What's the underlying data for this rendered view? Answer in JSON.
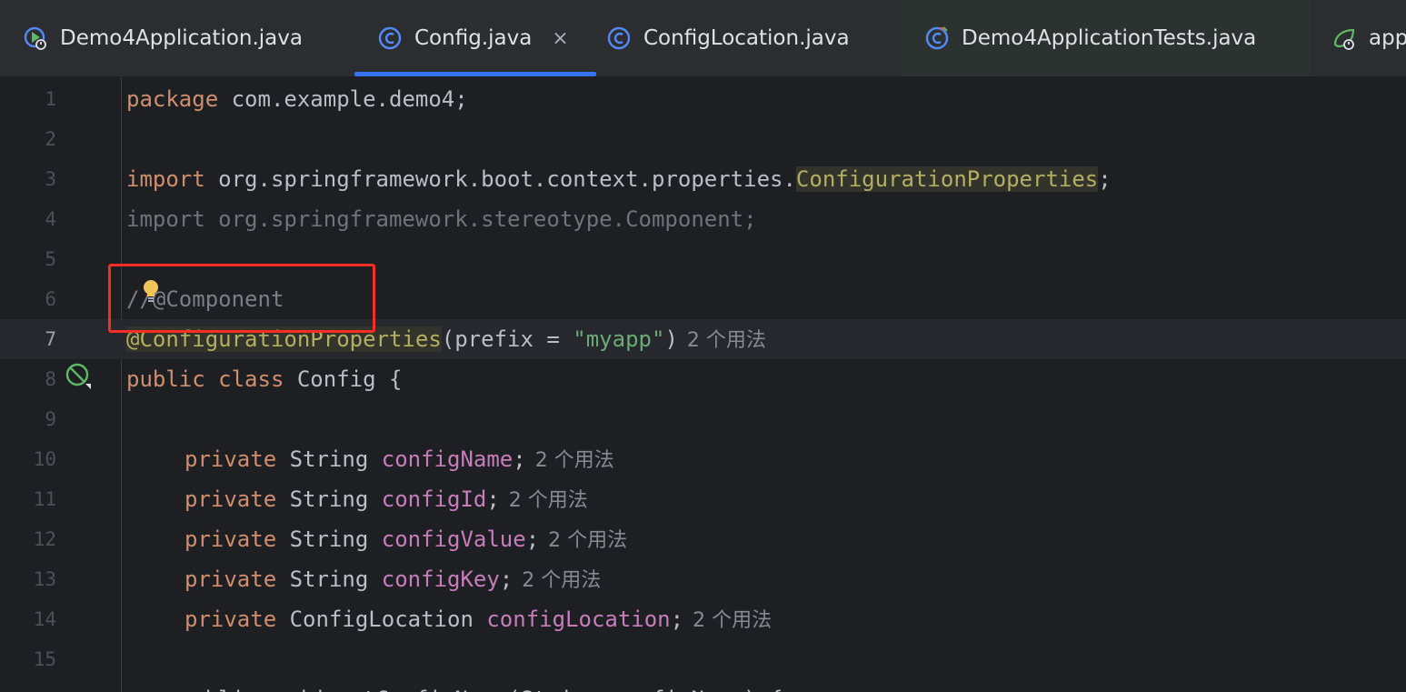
{
  "tabs": [
    {
      "label": "Demo4Application.java",
      "icon": "spring-boot-run-class-icon"
    },
    {
      "label": "Config.java",
      "icon": "class-icon",
      "active": true,
      "close": "×"
    },
    {
      "label": "ConfigLocation.java",
      "icon": "class-icon"
    },
    {
      "label": "Demo4ApplicationTests.java",
      "icon": "test-class-icon"
    },
    {
      "label": "app",
      "icon": "spring-config-icon"
    }
  ],
  "editor": {
    "current_line": 7,
    "lines": [
      {
        "n": "1"
      },
      {
        "n": "2"
      },
      {
        "n": "3"
      },
      {
        "n": "4"
      },
      {
        "n": "5"
      },
      {
        "n": "6"
      },
      {
        "n": "7"
      },
      {
        "n": "8"
      },
      {
        "n": "9"
      },
      {
        "n": "10"
      },
      {
        "n": "11"
      },
      {
        "n": "12"
      },
      {
        "n": "13"
      },
      {
        "n": "14"
      },
      {
        "n": "15"
      }
    ],
    "code": {
      "l1_kw": "package",
      "l1_rest": " com.example.demo4;",
      "l3_kw": "import",
      "l3_pkg": " org.springframework.boot.context.properties.",
      "l3_cls": "ConfigurationProperties",
      "l3_end": ";",
      "l4": "import org.springframework.stereotype.Component;",
      "l6": "//@Component",
      "l7_ann": "@ConfigurationProperties",
      "l7_open": "(prefix = ",
      "l7_str": "\"myapp\"",
      "l7_close": ")",
      "l8_kw": "public class",
      "l8_rest": " Config {",
      "f_kw": "private",
      "f1_type": " String ",
      "f1_name": "configName",
      "f2_type": " String ",
      "f2_name": "configId",
      "f3_type": " String ",
      "f3_name": "configValue",
      "f4_type": " String ",
      "f4_name": "configKey",
      "f5_type": " ConfigLocation ",
      "f5_name": "configLocation",
      "semi": ";",
      "usage_hint": "2 个用法",
      "l16_partial": "    public void setConfigName(String configName) {"
    }
  },
  "colors": {
    "accent": "#3574f0",
    "highlight_box": "#f52d23",
    "keyword": "#cf8e6d",
    "string": "#6aab73",
    "annotation": "#b3ae60",
    "field": "#c77dbb"
  }
}
